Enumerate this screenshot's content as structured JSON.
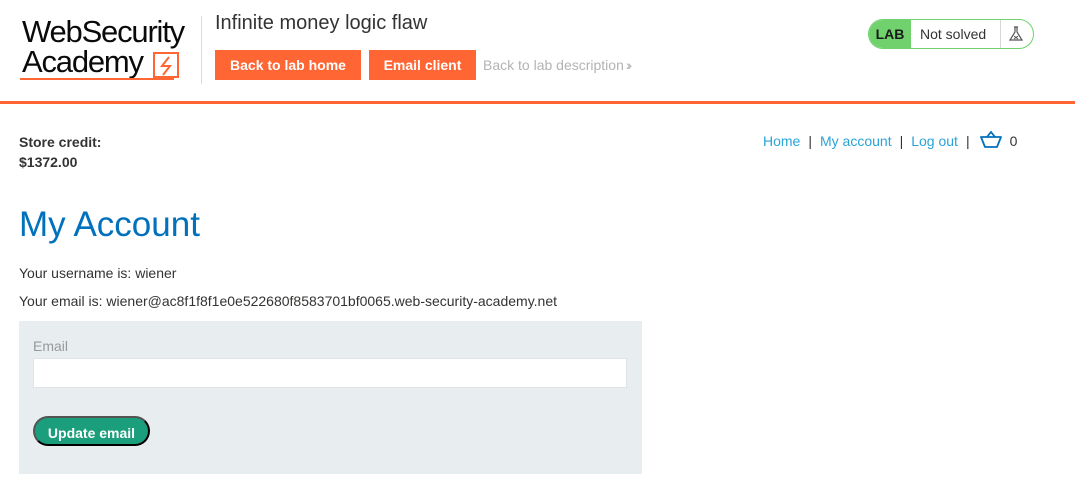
{
  "header": {
    "logo": {
      "line1": "WebSecurity",
      "line2": "Academy"
    },
    "lab_title": "Infinite money logic flaw",
    "back_to_lab_home": "Back to lab home",
    "email_client": "Email client",
    "back_to_description": "Back to lab description",
    "lab_badge": "LAB",
    "lab_status": "Not solved"
  },
  "store_credit": {
    "label": "Store credit:",
    "value": "$1372.00"
  },
  "nav": {
    "home": "Home",
    "my_account": "My account",
    "log_out": "Log out",
    "cart_count": "0"
  },
  "main": {
    "title": "My Account",
    "username_line": "Your username is: wiener",
    "email_line": "Your email is: wiener@ac8f1f8f1e0e522680f8583701bf0065.web-security-academy.net",
    "form": {
      "email_label": "Email",
      "email_value": "",
      "update_button": "Update email"
    }
  },
  "colors": {
    "accent_orange": "#ff6633",
    "link_blue": "#29a3d8",
    "title_blue": "#0071bc",
    "solved_green": "#70d16d",
    "button_teal": "#1a9e7c"
  },
  "icons": [
    "academy-logo-icon",
    "chevron-right-icon",
    "flask-icon",
    "cart-icon"
  ]
}
